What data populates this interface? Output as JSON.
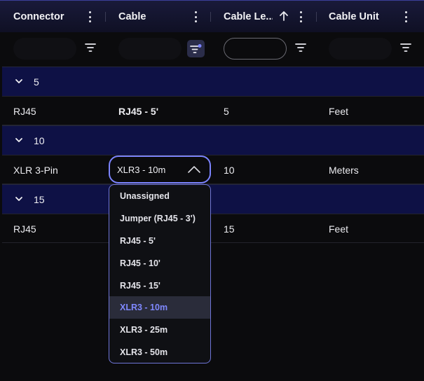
{
  "columns": [
    {
      "label": "Connector"
    },
    {
      "label": "Cable"
    },
    {
      "label": "Cable Le..."
    },
    {
      "label": "Cable Unit"
    }
  ],
  "groups": [
    {
      "label": "5",
      "row": {
        "connector": "RJ45",
        "cable": "RJ45 - 5'",
        "length": "5",
        "unit": "Feet"
      }
    },
    {
      "label": "10",
      "row": {
        "connector": "XLR 3-Pin",
        "cable": "XLR3 - 10m",
        "length": "10",
        "unit": "Meters"
      }
    },
    {
      "label": "15",
      "row": {
        "connector": "RJ45",
        "cable": "",
        "length": "15",
        "unit": "Feet"
      }
    }
  ],
  "cable_select": {
    "value": "XLR3 - 10m",
    "options": [
      "Unassigned",
      "Jumper (RJ45 - 3')",
      "RJ45 - 5'",
      "RJ45 - 10'",
      "RJ45 - 15'",
      "XLR3 - 10m",
      "XLR3 - 25m",
      "XLR3 - 50m"
    ],
    "selected_index": 5
  },
  "colors": {
    "header_bg": "#0f1024",
    "group_bg": "#0e1145",
    "accent": "#7c84ff",
    "filter_active_dot": "#7c84ff"
  },
  "icons": {
    "column_menu": "kebab-vertical-icon",
    "sort": "arrow-up-icon",
    "filter": "filter-lines-icon",
    "group_toggle": "chevron-down-icon",
    "select_caret": "chevron-up-icon"
  }
}
